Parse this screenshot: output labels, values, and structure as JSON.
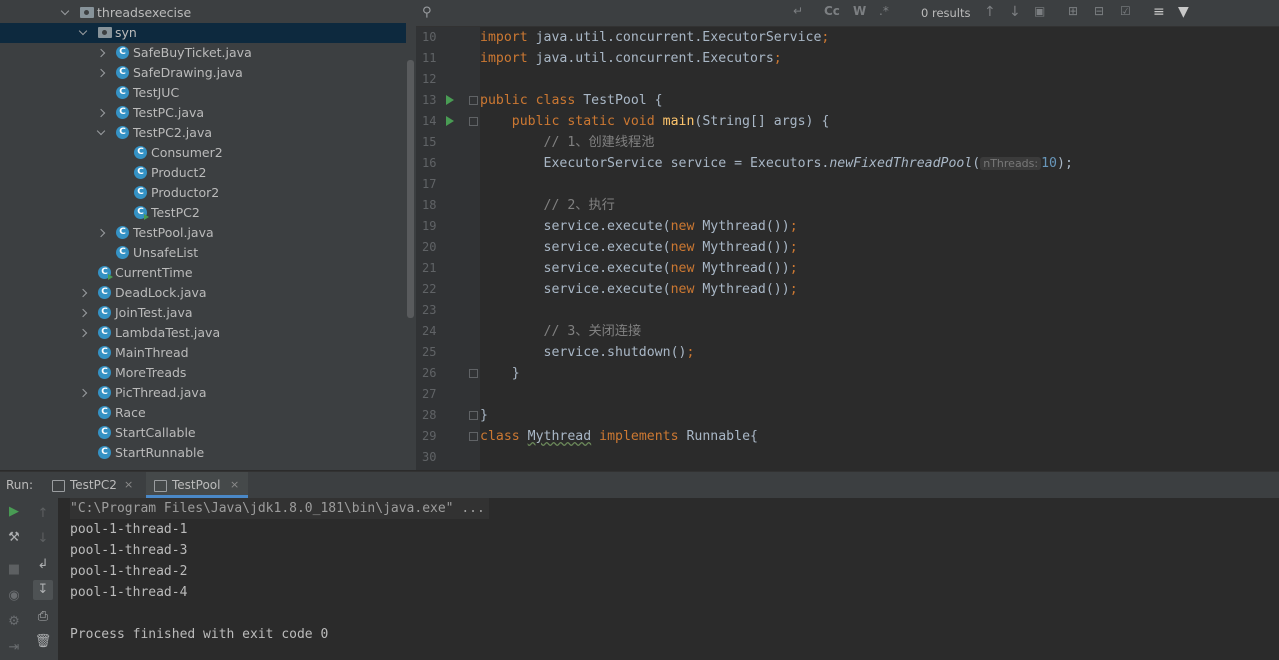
{
  "project_tree": [
    {
      "label": "threadsexecise",
      "kind": "folder",
      "chevron": "down",
      "indent": 62,
      "selected": false
    },
    {
      "label": "syn",
      "kind": "folder",
      "chevron": "down",
      "indent": 80,
      "selected": true
    },
    {
      "label": "SafeBuyTicket.java",
      "kind": "class",
      "chevron": "right",
      "indent": 98
    },
    {
      "label": "SafeDrawing.java",
      "kind": "class",
      "chevron": "right",
      "indent": 98
    },
    {
      "label": "TestJUC",
      "kind": "class",
      "chevron": "none",
      "indent": 98
    },
    {
      "label": "TestPC.java",
      "kind": "class",
      "chevron": "right",
      "indent": 98
    },
    {
      "label": "TestPC2.java",
      "kind": "class",
      "chevron": "down",
      "indent": 98
    },
    {
      "label": "Consumer2",
      "kind": "class",
      "chevron": "none",
      "indent": 116
    },
    {
      "label": "Product2",
      "kind": "class",
      "chevron": "none",
      "indent": 116
    },
    {
      "label": "Productor2",
      "kind": "class",
      "chevron": "none",
      "indent": 116
    },
    {
      "label": "TestPC2",
      "kind": "class-run",
      "chevron": "none",
      "indent": 116
    },
    {
      "label": "TestPool.java",
      "kind": "class",
      "chevron": "right",
      "indent": 98
    },
    {
      "label": "UnsafeList",
      "kind": "class",
      "chevron": "none",
      "indent": 98
    },
    {
      "label": "CurrentTime",
      "kind": "class-run",
      "chevron": "none",
      "indent": 80
    },
    {
      "label": "DeadLock.java",
      "kind": "class",
      "chevron": "right",
      "indent": 80
    },
    {
      "label": "JoinTest.java",
      "kind": "class",
      "chevron": "right",
      "indent": 80
    },
    {
      "label": "LambdaTest.java",
      "kind": "class",
      "chevron": "right",
      "indent": 80
    },
    {
      "label": "MainThread",
      "kind": "class",
      "chevron": "none",
      "indent": 80
    },
    {
      "label": "MoreTreads",
      "kind": "class",
      "chevron": "none",
      "indent": 80
    },
    {
      "label": "PicThread.java",
      "kind": "class",
      "chevron": "right",
      "indent": 80
    },
    {
      "label": "Race",
      "kind": "class",
      "chevron": "none",
      "indent": 80
    },
    {
      "label": "StartCallable",
      "kind": "class",
      "chevron": "none",
      "indent": 80
    },
    {
      "label": "StartRunnable",
      "kind": "class",
      "chevron": "none",
      "indent": 80
    }
  ],
  "editor": {
    "search_results": "0 results",
    "toolbar": {
      "match_case": "Cc",
      "words": "W",
      "regex": ".*"
    },
    "line_numbers": [
      "10",
      "11",
      "12",
      "13",
      "14",
      "15",
      "16",
      "17",
      "18",
      "19",
      "20",
      "21",
      "22",
      "23",
      "24",
      "25",
      "26",
      "27",
      "28",
      "29",
      "30"
    ],
    "run_lines": [
      "13",
      "14"
    ],
    "code": {
      "l10_kw": "import",
      "l10_rest": " java.util.concurrent.ExecutorService",
      "l10_semi": ";",
      "l11_kw": "import",
      "l11_rest": " java.util.concurrent.Executors",
      "l11_semi": ";",
      "l13_kw": "public class",
      "l13_rest": " TestPool {",
      "l14_indent": "    ",
      "l14_kw": "public static void",
      "l14_fn": "main",
      "l14_rest": "(String[] args) {",
      "l15_indent": "        ",
      "l15_cm": "// 1、创建线程池",
      "l16_indent": "        ",
      "l16_pre": "ExecutorService service = Executors.",
      "l16_it": "newFixedThreadPool",
      "l16_paren": "(",
      "l16_hint": "nThreads:",
      "l16_num": "10",
      "l16_end": ");",
      "l18_indent": "        ",
      "l18_cm": "// 2、执行",
      "l19_indent": "        ",
      "l19_pre": "service.execute(",
      "l19_kw": "new",
      "l19_post": " Mythread())",
      "l19_semi": ";",
      "l20_indent": "        ",
      "l20_pre": "service.execute(",
      "l20_kw": "new",
      "l20_post": " Mythread())",
      "l20_semi": ";",
      "l21_indent": "        ",
      "l21_pre": "service.execute(",
      "l21_kw": "new",
      "l21_post": " Mythread())",
      "l21_semi": ";",
      "l22_indent": "        ",
      "l22_pre": "service.execute(",
      "l22_kw": "new",
      "l22_post": " Mythread())",
      "l22_semi": ";",
      "l24_indent": "        ",
      "l24_cm": "// 3、关闭连接",
      "l25_indent": "        ",
      "l25_pre": "service.shutdown()",
      "l25_semi": ";",
      "l26_indent": "    ",
      "l26_rest": "}",
      "l28_rest": "}",
      "l29_kw": "class",
      "l29_name": "Mythread",
      "l29_kw2": "implements",
      "l29_rest": " Runnable{"
    }
  },
  "run_panel": {
    "label": "Run:",
    "tabs": [
      {
        "label": "TestPC2",
        "close": "×",
        "active": false
      },
      {
        "label": "TestPool",
        "close": "×",
        "active": true
      }
    ],
    "console": [
      "\"C:\\Program Files\\Java\\jdk1.8.0_181\\bin\\java.exe\" ...",
      "pool-1-thread-1",
      "pool-1-thread-3",
      "pool-1-thread-2",
      "pool-1-thread-4",
      "",
      "Process finished with exit code 0"
    ]
  },
  "colors": {
    "keyword": "#cc7832",
    "method": "#ffc66d",
    "comment": "#808080",
    "number": "#6897bb",
    "run_green": "#499c54",
    "class_icon": "#3592c4"
  }
}
